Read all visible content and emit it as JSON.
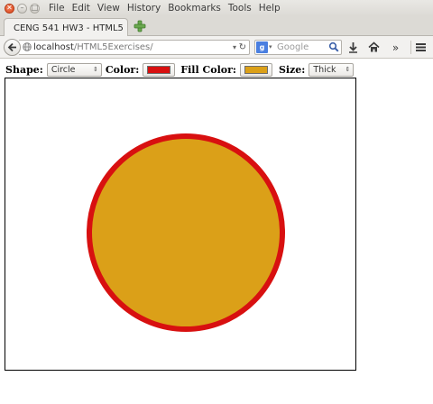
{
  "menubar": {
    "items": [
      "File",
      "Edit",
      "View",
      "History",
      "Bookmarks",
      "Tools",
      "Help"
    ]
  },
  "tab": {
    "title": "CENG 541 HW3 - HTML5"
  },
  "navbar": {
    "url_host": "localhost",
    "url_path": "/HTML5Exercises/",
    "search_placeholder": "Google"
  },
  "controls": {
    "shape_label": "Shape:",
    "shape_value": "Circle",
    "color_label": "Color:",
    "color_value": "#d81010",
    "fill_label": "Fill Color:",
    "fill_value": "#dba018",
    "size_label": "Size:",
    "size_value": "Thick"
  },
  "colors": {
    "stroke": "#d81010",
    "fill": "#dba018"
  }
}
